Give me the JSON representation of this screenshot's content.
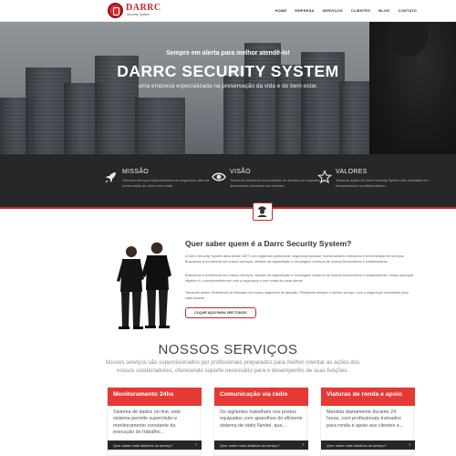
{
  "brand": {
    "name": "DARRC",
    "tagline": "Security System"
  },
  "nav": {
    "items": [
      {
        "label": "HOME"
      },
      {
        "label": "EMPRESA"
      },
      {
        "label": "SERVIÇOS"
      },
      {
        "label": "CLIENTES"
      },
      {
        "label": "BLOG"
      },
      {
        "label": "CONTATO"
      }
    ]
  },
  "hero": {
    "kicker": "Sempre em alerta para melhor atendê-lo!",
    "title": "DARRC SECURITY SYSTEM",
    "subtitle": "uma empresa especializada na preservação da vida e do bem estar."
  },
  "features": [
    {
      "icon": "rocket-icon",
      "title": "MISSÃO",
      "text": "Oferecer serviços especializados em segurança, afim da preservação da vida e bem estar."
    },
    {
      "icon": "eye-icon",
      "title": "VISÃO",
      "text": "Tornar-se referência na prestação de serviços de segurança e desenvolver parcerias com clientes."
    },
    {
      "icon": "star-icon",
      "title": "VALORES",
      "text": "Todas as ações da Darrc Security System são baseadas em transparência e profissionalismo."
    }
  ],
  "about": {
    "title": "Quer saber quem é a Darrc Security System?",
    "paragraphs": [
      "A Darrc Security System atua desde 1997 com vigilância patrimonial, segurança pessoal, monitoramento eletrônico e terceirização de serviços. Buscamos a excelência em nossos serviços, através da capacitação e reciclagem contínua de nossos funcionários e colaboradores.",
      "Buscamos a excelência em nossos serviços, através da capacitação e reciclagem contínua de nossos funcionários e colaboradores. Nosso principal objetivo é o comprometimento com a segurança e bem estar de cada cliente.",
      "Tornando assim, Referência de Mercado em nosso segmento de atuação. Prestando sempre o melhor serviço, com a segurança necessária para cada quadro."
    ],
    "button": "CLIQUE AQUI PARA VER TODOS!"
  },
  "services": {
    "title": "NOSSOS SERVIÇOS",
    "intro": "Nossos serviços são supervisionados por profissionais preparados para melhor orientar as ações dos nossos colaboradores, oferecendo suporte necessário para o desempenho de suas funções.",
    "cards": [
      {
        "title": "Monitoramento 24hs",
        "text": "Sistema de dados on-line, este sistema permite supervisão e monitoramento constante da execução do trabalho...",
        "link": "Quer saber mais detalhes do serviço?"
      },
      {
        "title": "Comunicação via rádio",
        "text": "Os vigilantes trabalham nos postos equipados com aparelhos do eficiente sistema de rádio Nextel, que...",
        "link": "Quer saber mais detalhes do serviço?"
      },
      {
        "title": "Viaturas de ronda e apoio",
        "text": "Mantida diariamente durante 24 horas, com profissionais treinados para ronda e apoio aos clientes e...",
        "link": "Quer saber mais detalhes do serviço?"
      }
    ]
  },
  "colors": {
    "accent": "#c62828",
    "card_head": "#e53935",
    "dark_band": "#262728"
  }
}
